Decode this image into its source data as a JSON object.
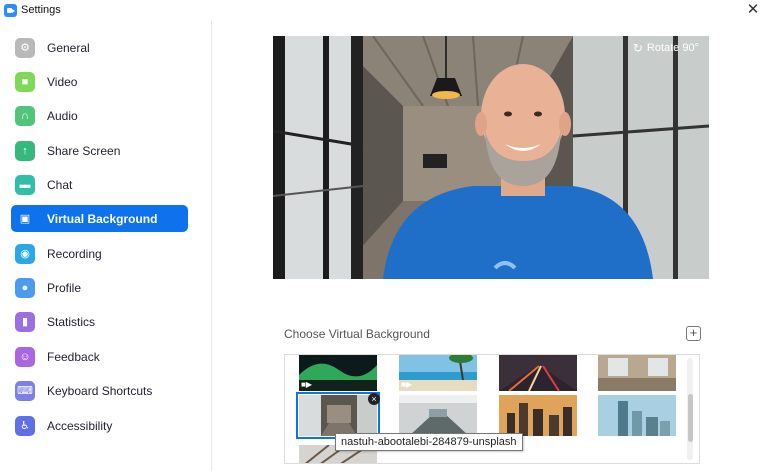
{
  "window": {
    "title": "Settings",
    "close_glyph": "✕",
    "app_icon": "zoom-camera-icon"
  },
  "sidebar": {
    "items": [
      {
        "label": "General",
        "icon": "gear-icon",
        "color": "#b9b9b9",
        "glyph": "⚙"
      },
      {
        "label": "Video",
        "icon": "video-camera-icon",
        "color": "#7ed957",
        "glyph": "■"
      },
      {
        "label": "Audio",
        "icon": "headphones-icon",
        "color": "#52c47c",
        "glyph": "∩"
      },
      {
        "label": "Share Screen",
        "icon": "share-screen-icon",
        "color": "#34b87e",
        "glyph": "↑"
      },
      {
        "label": "Chat",
        "icon": "chat-bubble-icon",
        "color": "#2fbfa7",
        "glyph": "▬"
      },
      {
        "label": "Virtual Background",
        "icon": "virtual-background-icon",
        "color": "#0e72ed",
        "glyph": "▣",
        "active": true
      },
      {
        "label": "Recording",
        "icon": "record-icon",
        "color": "#2aa7e8",
        "glyph": "◉"
      },
      {
        "label": "Profile",
        "icon": "person-icon",
        "color": "#4b9cf0",
        "glyph": "●"
      },
      {
        "label": "Statistics",
        "icon": "bar-chart-icon",
        "color": "#9b6fe0",
        "glyph": "▮"
      },
      {
        "label": "Feedback",
        "icon": "smiley-icon",
        "color": "#a866e0",
        "glyph": "☺"
      },
      {
        "label": "Keyboard Shortcuts",
        "icon": "keyboard-icon",
        "color": "#7c7fe8",
        "glyph": "⌨"
      },
      {
        "label": "Accessibility",
        "icon": "accessibility-icon",
        "color": "#5f6fe6",
        "glyph": "♿"
      }
    ]
  },
  "preview": {
    "rotate_label": "Rotate 90°",
    "rotate_icon": "rotate-icon",
    "shirt_color": "#1f6fc8"
  },
  "gallery": {
    "title": "Choose Virtual Background",
    "add_icon": "plus-icon",
    "add_glyph": "+",
    "thumbnails": [
      {
        "name": "aurora-night-sky",
        "video": true
      },
      {
        "name": "tropical-beach",
        "video": true
      },
      {
        "name": "highway-light-trails",
        "video": false
      },
      {
        "name": "office-interior",
        "video": false
      },
      {
        "name": "nastuh-abootalebi-284879-unsplash",
        "selected": true
      },
      {
        "name": "conference-room",
        "video": false
      },
      {
        "name": "city-skyline-dusk",
        "video": false
      },
      {
        "name": "modern-skyscrapers",
        "video": false
      },
      {
        "name": "bare-tree-branches",
        "video": false
      }
    ],
    "tooltip": "nastuh-abootalebi-284879-unsplash",
    "remove_glyph": "×"
  },
  "accent_color": "#0e72ed"
}
